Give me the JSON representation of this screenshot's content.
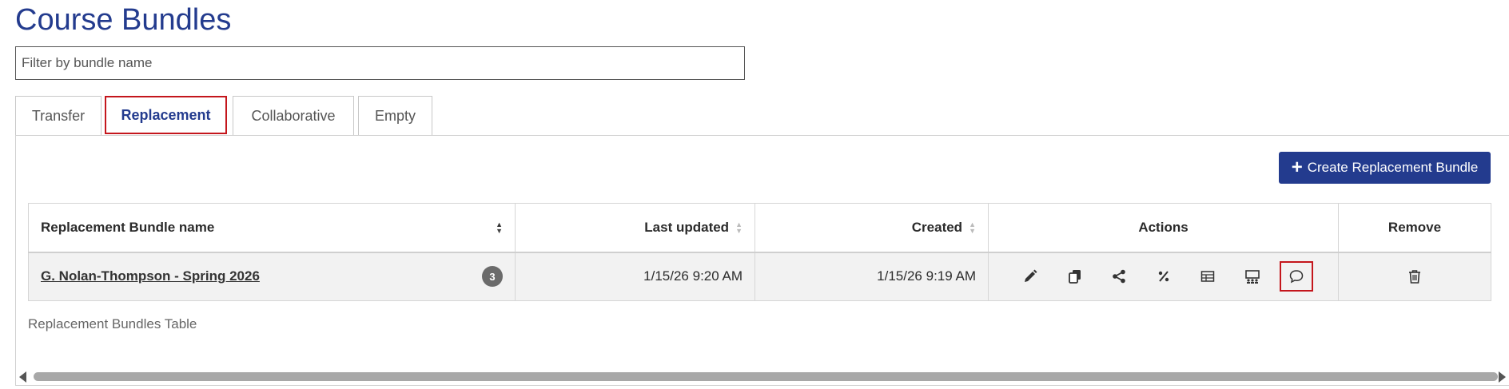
{
  "page": {
    "title": "Course Bundles"
  },
  "filter": {
    "placeholder": "Filter by bundle name",
    "value": ""
  },
  "tabs": [
    {
      "label": "Transfer",
      "active": false
    },
    {
      "label": "Replacement",
      "active": true
    },
    {
      "label": "Collaborative",
      "active": false
    },
    {
      "label": "Empty",
      "active": false
    }
  ],
  "toolbar": {
    "create_label": "Create Replacement Bundle",
    "create_icon": "plus-icon"
  },
  "table": {
    "columns": {
      "name": "Replacement Bundle name",
      "updated": "Last updated",
      "created": "Created",
      "actions": "Actions",
      "remove": "Remove"
    },
    "rows": [
      {
        "name": "G. Nolan-Thompson - Spring 2026",
        "count": "3",
        "updated": "1/15/26 9:20 AM",
        "created": "1/15/26 9:19 AM",
        "actions": [
          "pencil-icon",
          "copy-icon",
          "share-icon",
          "percent-icon",
          "table-icon",
          "presentation-icon",
          "comment-icon"
        ],
        "remove_icon": "trash-icon"
      }
    ],
    "caption": "Replacement Bundles Table"
  },
  "colors": {
    "brand": "#233b8e",
    "highlight": "#c4161c",
    "row_bg": "#f2f2f2"
  }
}
